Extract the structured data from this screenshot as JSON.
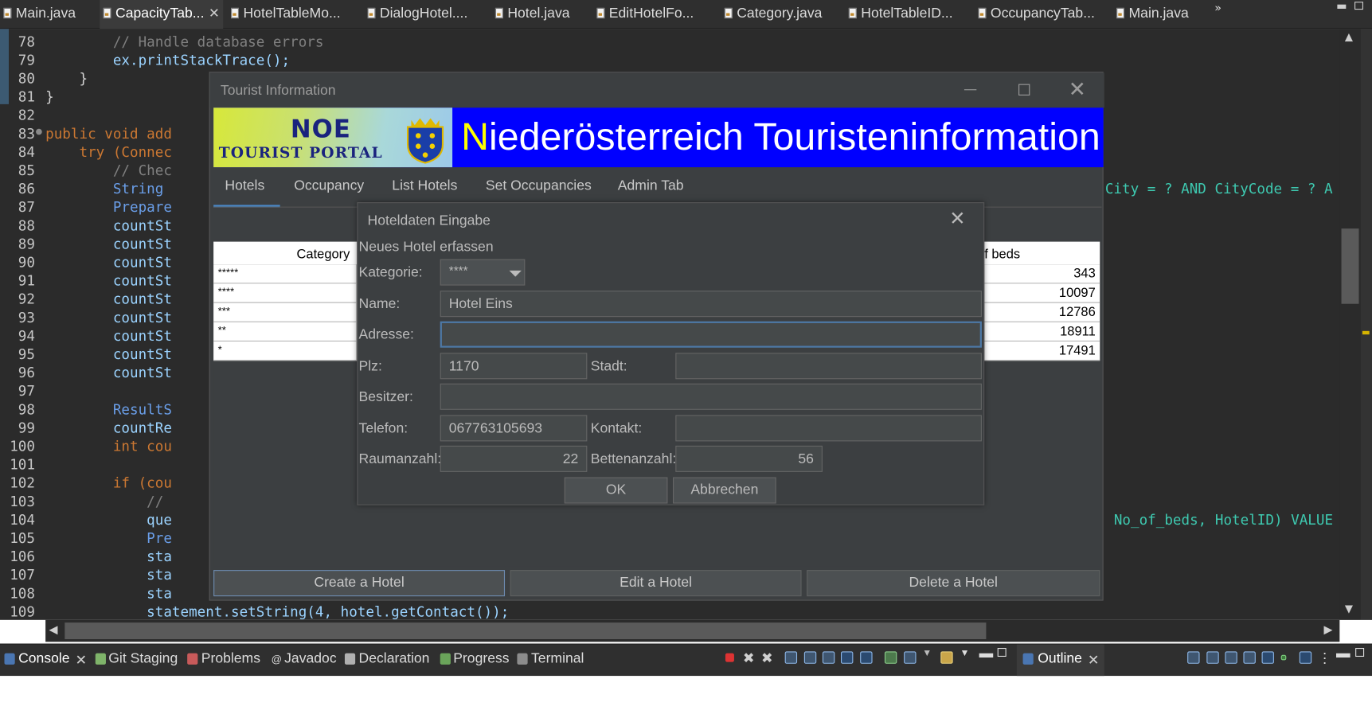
{
  "editor_tabs": [
    {
      "label": "Main.java"
    },
    {
      "label": "CapacityTab..."
    },
    {
      "label": "HotelTableMo..."
    },
    {
      "label": "DialogHotel...."
    },
    {
      "label": "Hotel.java"
    },
    {
      "label": "EditHotelFo..."
    },
    {
      "label": "Category.java"
    },
    {
      "label": "HotelTableID..."
    },
    {
      "label": "OccupancyTab..."
    },
    {
      "label": "Main.java"
    }
  ],
  "more_tabs_label": "»",
  "editor": {
    "line_numbers": [
      "78",
      "79",
      "80",
      "81",
      "82",
      "83",
      "84",
      "85",
      "86",
      "87",
      "88",
      "89",
      "90",
      "91",
      "92",
      "93",
      "94",
      "95",
      "96",
      "97",
      "98",
      "99",
      "100",
      "101",
      "102",
      "103",
      "104",
      "105",
      "106",
      "107",
      "108",
      "109"
    ],
    "lines": [
      "        // Handle database errors",
      "        ex.printStackTrace();",
      "    }",
      "}",
      "",
      "public void add",
      "    try (Connec",
      "        // Chec",
      "        String",
      "        Prepare",
      "        countSt",
      "        countSt",
      "        countSt",
      "        countSt",
      "        countSt",
      "        countSt",
      "        countSt",
      "        countSt",
      "        countSt",
      "",
      "        ResultS",
      "        countRe",
      "        int cou",
      "",
      "        if (cou",
      "            //",
      "            que",
      "            Pre",
      "            sta",
      "            sta",
      "            sta",
      "            statement.setString(4, hotel.getContact());"
    ],
    "right_snippets": [
      "City = ? AND CityCode = ? A",
      "No_of_beds, HotelID) VALUE"
    ]
  },
  "bottom_tabs": [
    {
      "label": "Console"
    },
    {
      "label": "Git Staging"
    },
    {
      "label": "Problems"
    },
    {
      "label": "Javadoc"
    },
    {
      "label": "Declaration"
    },
    {
      "label": "Progress"
    },
    {
      "label": "Terminal"
    }
  ],
  "outline_tab": {
    "label": "Outline"
  },
  "tourist_window": {
    "title": "Tourist Information",
    "banner": {
      "logo_top": "NOE",
      "logo_bottom": "TOURIST PORTAL",
      "title_first": "N",
      "title_rest": "iederösterreich Touristeninformation"
    },
    "tabs": [
      {
        "label": "Hotels"
      },
      {
        "label": "Occupancy"
      },
      {
        "label": "List Hotels"
      },
      {
        "label": "Set Occupancies"
      },
      {
        "label": "Admin Tab"
      }
    ],
    "table": {
      "col_category": "Category",
      "col_beds": "f beds",
      "categories": [
        "*****",
        "****",
        "***",
        "**",
        "*"
      ],
      "beds": [
        "343",
        "10097",
        "12786",
        "18911",
        "17491"
      ]
    },
    "buttons": {
      "create": "Create a Hotel",
      "edit": "Edit a Hotel",
      "delete": "Delete a Hotel"
    }
  },
  "dialog": {
    "title": "Hoteldaten Eingabe",
    "subtitle": "Neues Hotel erfassen",
    "labels": {
      "kategorie": "Kategorie:",
      "name": "Name:",
      "adresse": "Adresse:",
      "plz": "Plz:",
      "stadt": "Stadt:",
      "besitzer": "Besitzer:",
      "telefon": "Telefon:",
      "kontakt": "Kontakt:",
      "raumanzahl": "Raumanzahl:",
      "bettenanzahl": "Bettenanzahl:"
    },
    "values": {
      "kategorie": "****",
      "name": "Hotel Eins",
      "adresse": "",
      "plz": "1170",
      "stadt": "",
      "besitzer": "",
      "telefon": "067763105693",
      "kontakt": "",
      "raumanzahl": "22",
      "bettenanzahl": "56"
    },
    "ok_label": "OK",
    "cancel_label": "Abbrechen"
  }
}
